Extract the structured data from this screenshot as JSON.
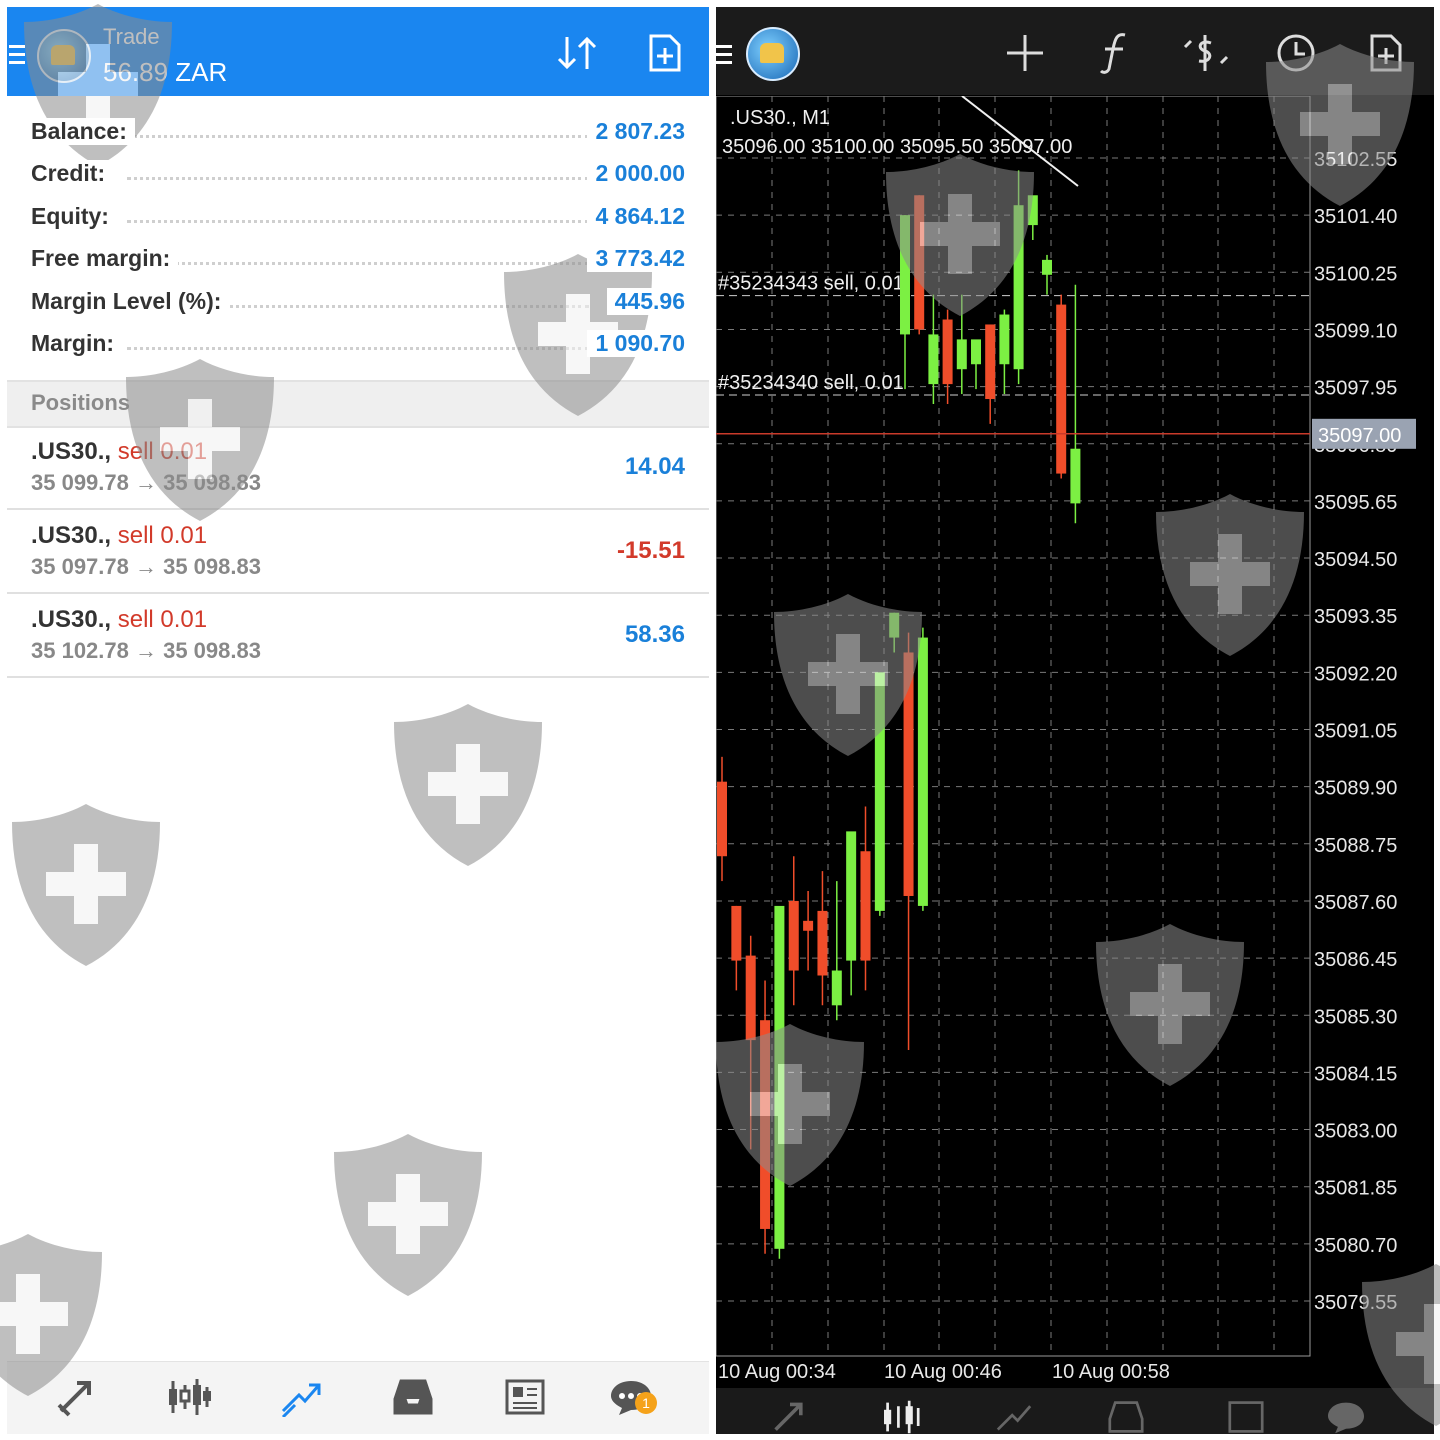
{
  "trade": {
    "title": "Trade",
    "balance_display": "56.89 ZAR",
    "account": [
      {
        "label": "Balance:",
        "value": "2 807.23"
      },
      {
        "label": "Credit:",
        "value": "2 000.00"
      },
      {
        "label": "Equity:",
        "value": "4 864.12"
      },
      {
        "label": "Free margin:",
        "value": "3 773.42"
      },
      {
        "label": "Margin Level (%):",
        "value": "445.96"
      },
      {
        "label": "Margin:",
        "value": "1 090.70"
      }
    ],
    "positions_header": "Positions",
    "positions": [
      {
        "symbol": ".US30.,",
        "side": "sell 0.01",
        "prices": "35 099.78 → 35 098.83",
        "profit": "14.04",
        "profit_color": "#1a80d9"
      },
      {
        "symbol": ".US30.,",
        "side": "sell 0.01",
        "prices": "35 097.78 → 35 098.83",
        "profit": "-15.51",
        "profit_color": "#d23a2a"
      },
      {
        "symbol": ".US30.,",
        "side": "sell 0.01",
        "prices": "35 102.78 → 35 098.83",
        "profit": "58.36",
        "profit_color": "#1a80d9"
      }
    ],
    "nav_badge": "1",
    "accent_color": "#1a86f0"
  },
  "chart_data": {
    "type": "candlestick",
    "title": ".US30., M1",
    "header_values": "35096.00 35100.00 35095.50 35097.00",
    "order_lines": [
      {
        "label": "#35234343 sell, 0.01",
        "price": 35099.78
      },
      {
        "label": "#35234340 sell, 0.01",
        "price": 35097.78
      }
    ],
    "current_price": "35097.00",
    "ylim": [
      35079.0,
      35104.0
    ],
    "y_ticks": [
      "35102.55",
      "35101.40",
      "35100.25",
      "35099.10",
      "35097.95",
      "35096.80",
      "35095.65",
      "35094.50",
      "35093.35",
      "35092.20",
      "35091.05",
      "35089.90",
      "35088.75",
      "35087.60",
      "35086.45",
      "35085.30",
      "35084.15",
      "35083.00",
      "35081.85",
      "35080.70",
      "35079.55"
    ],
    "x_ticks": [
      "10 Aug 00:34",
      "10 Aug 00:46",
      "10 Aug 00:58"
    ],
    "bull_color": "#7cf043",
    "bear_color": "#f04d2a",
    "candles": [
      {
        "o": 35090.0,
        "h": 35090.5,
        "l": 35088.0,
        "c": 35088.5
      },
      {
        "o": 35087.5,
        "h": 35087.5,
        "l": 35085.8,
        "c": 35086.4
      },
      {
        "o": 35086.5,
        "h": 35086.9,
        "l": 35082.6,
        "c": 35084.8
      },
      {
        "o": 35085.2,
        "h": 35086.0,
        "l": 35080.5,
        "c": 35081.0
      },
      {
        "o": 35080.6,
        "h": 35081.3,
        "l": 35080.4,
        "c": 35087.5
      },
      {
        "o": 35087.6,
        "h": 35088.5,
        "l": 35085.5,
        "c": 35086.2
      },
      {
        "o": 35087.2,
        "h": 35087.8,
        "l": 35086.2,
        "c": 35087.0
      },
      {
        "o": 35087.4,
        "h": 35088.2,
        "l": 35085.5,
        "c": 35086.1
      },
      {
        "o": 35085.5,
        "h": 35088.0,
        "l": 35085.2,
        "c": 35086.2
      },
      {
        "o": 35086.4,
        "h": 35088.9,
        "l": 35085.7,
        "c": 35089.0
      },
      {
        "o": 35088.6,
        "h": 35089.5,
        "l": 35085.8,
        "c": 35086.4
      },
      {
        "o": 35087.4,
        "h": 35091.9,
        "l": 35087.3,
        "c": 35092.2
      },
      {
        "o": 35092.9,
        "h": 35093.4,
        "l": 35092.6,
        "c": 35093.4
      },
      {
        "o": 35092.6,
        "h": 35093.0,
        "l": 35084.6,
        "c": 35087.7
      },
      {
        "o": 35087.5,
        "h": 35093.1,
        "l": 35087.4,
        "c": 35092.9
      },
      {
        "o": 35099.0,
        "h": 35101.4,
        "l": 35097.9,
        "c": 35101.4
      },
      {
        "o": 35101.8,
        "h": 35101.8,
        "l": 35099.0,
        "c": 35099.1
      },
      {
        "o": 35098.0,
        "h": 35099.8,
        "l": 35097.6,
        "c": 35099.0
      },
      {
        "o": 35099.3,
        "h": 35099.5,
        "l": 35097.6,
        "c": 35098.0
      },
      {
        "o": 35098.3,
        "h": 35099.8,
        "l": 35097.8,
        "c": 35098.9
      },
      {
        "o": 35098.4,
        "h": 35098.5,
        "l": 35097.9,
        "c": 35098.9
      },
      {
        "o": 35099.2,
        "h": 35099.2,
        "l": 35097.2,
        "c": 35097.7
      },
      {
        "o": 35098.4,
        "h": 35099.5,
        "l": 35097.8,
        "c": 35099.4
      },
      {
        "o": 35098.3,
        "h": 35102.3,
        "l": 35098.0,
        "c": 35101.6
      },
      {
        "o": 35101.2,
        "h": 35101.6,
        "l": 35100.9,
        "c": 35101.8
      },
      {
        "o": 35100.2,
        "h": 35100.6,
        "l": 35099.8,
        "c": 35100.5
      },
      {
        "o": 35099.6,
        "h": 35099.8,
        "l": 35096.1,
        "c": 35096.2
      },
      {
        "o": 35095.6,
        "h": 35100.0,
        "l": 35095.2,
        "c": 35096.7
      }
    ]
  }
}
